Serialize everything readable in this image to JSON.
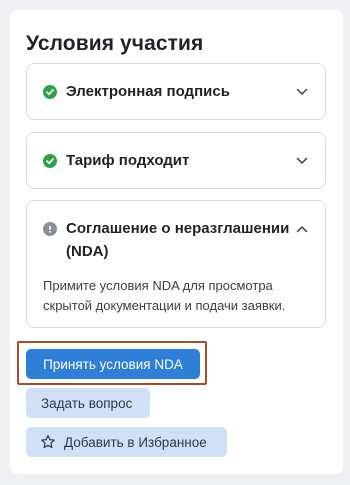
{
  "panel": {
    "title": "Условия участия"
  },
  "cards": [
    {
      "label": "Электронная подпись",
      "status_icon": "check-circle-icon",
      "status_color": "#2fa14a",
      "expanded": false,
      "chevron": "chevron-down-icon"
    },
    {
      "label": "Тариф подходит",
      "status_icon": "check-circle-icon",
      "status_color": "#2fa14a",
      "expanded": false,
      "chevron": "chevron-down-icon"
    },
    {
      "label": "Соглашение о неразглашении (NDA)",
      "status_icon": "exclamation-circle-icon",
      "status_color": "#8a8f96",
      "expanded": true,
      "chevron": "chevron-up-icon",
      "description": "Примите условия NDA для просмотра скрытой документации и подачи заявки."
    }
  ],
  "actions": {
    "primary_label": "Принять условия NDA",
    "ask_label": "Задать вопрос",
    "favorite_label": "Добавить в Избранное",
    "favorite_icon": "star-outline-icon"
  },
  "colors": {
    "primary": "#2f7fd6",
    "secondary_bg": "#cfe0f7",
    "highlight_border": "#a34d27",
    "success": "#2fa14a"
  }
}
